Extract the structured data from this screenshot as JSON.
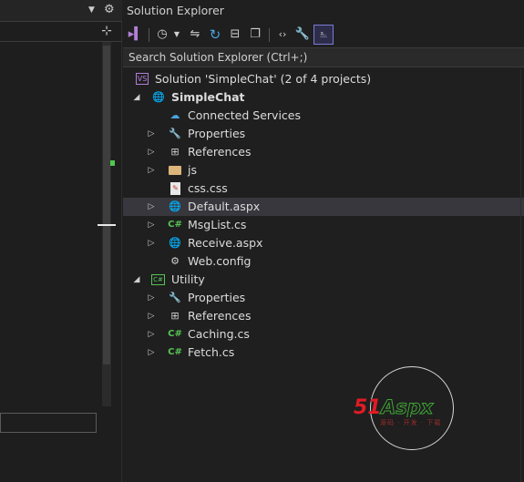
{
  "explorer": {
    "title": "Solution Explorer",
    "search_placeholder": "Search Solution Explorer (Ctrl+;)"
  },
  "toolbar_icons": [
    "vs-switch-icon",
    "history-icon",
    "dropdown-icon",
    "sync-icon",
    "refresh-icon",
    "collapse-all-icon",
    "copy-icon",
    "code-icon",
    "wrench-icon",
    "preview-icon"
  ],
  "tree": {
    "solution": {
      "label": "Solution 'SimpleChat' (2 of 4 projects)",
      "icon": "solution-icon"
    },
    "projects": [
      {
        "label": "SimpleChat",
        "bold": true,
        "icon": "web-project-icon",
        "items": [
          {
            "label": "Connected Services",
            "icon": "connected-services-icon",
            "expandable": false
          },
          {
            "label": "Properties",
            "icon": "wrench-icon",
            "expandable": true
          },
          {
            "label": "References",
            "icon": "references-icon",
            "expandable": true
          },
          {
            "label": "js",
            "icon": "folder-icon",
            "expandable": true
          },
          {
            "label": "css.css",
            "icon": "css-file-icon",
            "expandable": false
          },
          {
            "label": "Default.aspx",
            "icon": "aspx-file-icon",
            "expandable": true,
            "selected": true
          },
          {
            "label": "MsgList.cs",
            "icon": "csharp-file-icon",
            "expandable": true
          },
          {
            "label": "Receive.aspx",
            "icon": "aspx-file-icon",
            "expandable": true
          },
          {
            "label": "Web.config",
            "icon": "config-file-icon",
            "expandable": false
          }
        ]
      },
      {
        "label": "Utility",
        "bold": false,
        "icon": "csharp-library-icon",
        "items": [
          {
            "label": "Properties",
            "icon": "wrench-icon",
            "expandable": true
          },
          {
            "label": "References",
            "icon": "references-icon",
            "expandable": true
          },
          {
            "label": "Caching.cs",
            "icon": "csharp-file-icon",
            "expandable": true
          },
          {
            "label": "Fetch.cs",
            "icon": "csharp-file-icon",
            "expandable": true
          }
        ]
      }
    ]
  },
  "watermark": {
    "brand": "51Aspx",
    "brand_num": "51",
    "brand_text": "Aspx",
    "tagline": "源码 · 开发 · 下载"
  },
  "colors": {
    "background": "#1f1f1f",
    "selection": "#37373d",
    "csharp": "#55c455",
    "web": "#4aa3df",
    "solution": "#b180d7",
    "brand_red": "#e01b24",
    "brand_green": "#3fa535"
  }
}
